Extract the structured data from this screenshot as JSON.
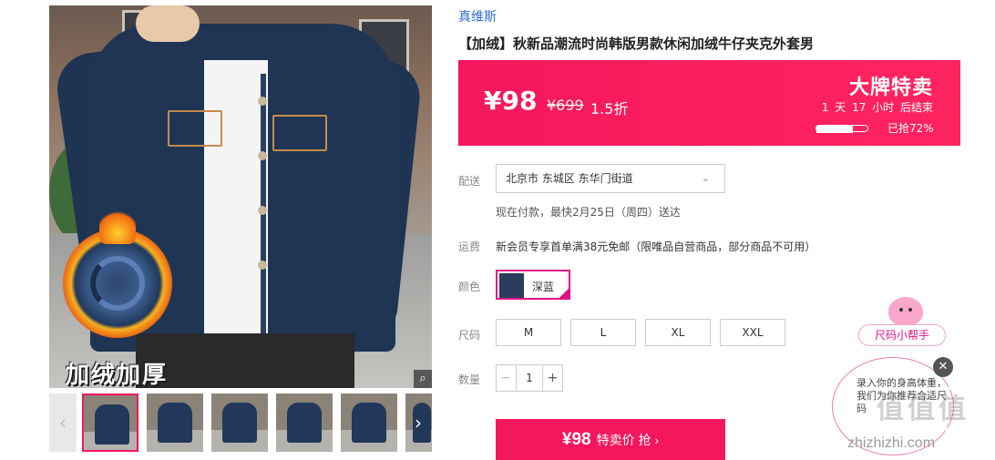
{
  "product": {
    "brand": "真维斯",
    "title": "【加绒】秋新品潮流时尚韩版男款休闲加绒牛仔夹克外套男",
    "image_caption": "加绒加厚"
  },
  "price_panel": {
    "current_price": "¥98",
    "original_price": "¥699",
    "discount": "1.5折",
    "sale_title": "大牌特卖",
    "countdown": "1 天 17 小时 后结束",
    "grabbed_fraction": 0.72,
    "grabbed_text": "已抢72%"
  },
  "shipping": {
    "label": "配送",
    "address": "北京市 东城区 东华门街道",
    "note": "现在付款，最快2月25日（周四）送达"
  },
  "fee": {
    "label": "运费",
    "text": "新会员专享首单满38元免邮（限唯品自营商品，部分商品不可用）"
  },
  "color": {
    "label": "颜色",
    "selected": "深蓝"
  },
  "size": {
    "label": "尺码",
    "options": [
      "M",
      "L",
      "XL",
      "XXL"
    ]
  },
  "quantity": {
    "label": "数量",
    "minus": "−",
    "value": "1",
    "plus": "+"
  },
  "buy_button": {
    "price": "¥98",
    "text": "特卖价 抢 ›"
  },
  "size_helper": {
    "title": "尺码小帮手",
    "text": "录入你的身高体重，我们为你推荐合适尺码",
    "close": "✕"
  },
  "watermark": {
    "logo_text": "值值值",
    "url": "zhizhizhi.com"
  },
  "icons": [
    "zoom-icon",
    "arrow-left-icon",
    "arrow-right-icon",
    "chevron-down-icon",
    "close-icon",
    "check-icon"
  ],
  "colors": {
    "accent": "#f5175d",
    "brand_link": "#2b6cd5",
    "selected_border": "#e0128a"
  }
}
